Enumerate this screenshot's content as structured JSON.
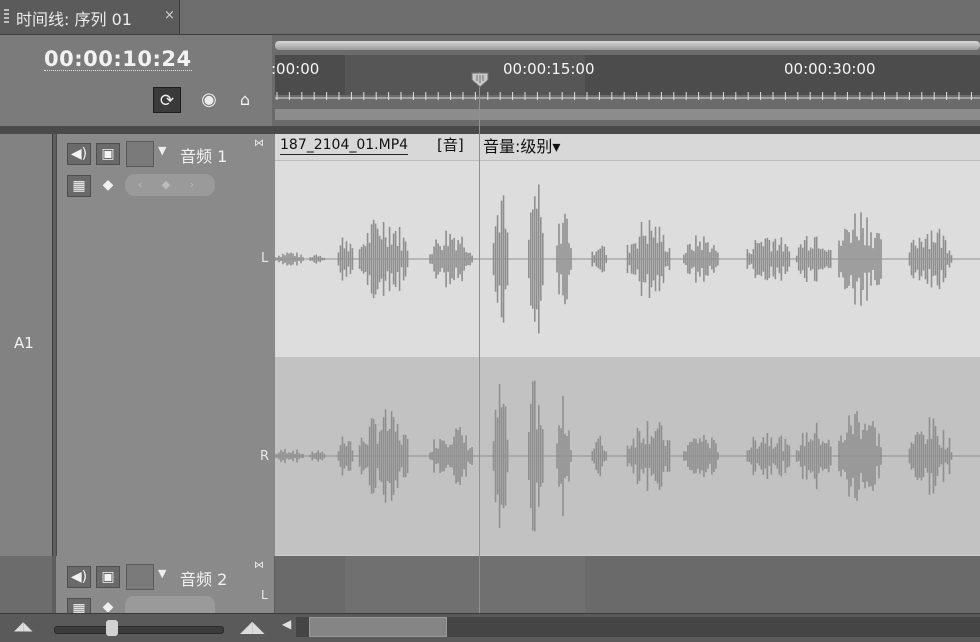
{
  "panel": {
    "tab_title": "时间线: 序列 01",
    "close_glyph": "×",
    "timecode": "00:00:10:24"
  },
  "toolbar": {
    "snap_icon": "snap-icon",
    "marker_icon": "marker-icon",
    "keyframe_icon": "keyframe-icon",
    "snap_glyph": "⟳",
    "marker_glyph": "◉",
    "keyframe_glyph": "⌂"
  },
  "ruler": {
    "labels": [
      ":00:00",
      "00:00:15:00",
      "00:00:30:00"
    ]
  },
  "tracks": [
    {
      "id": "A1",
      "name": "音频 1",
      "speaker_glyph": "◀)",
      "lock_glyph": "▣",
      "collapse_glyph": "▼",
      "wave_glyph": "▦",
      "kf_glyph": "◆",
      "nav_glyph": "‹ ◆ ›",
      "clip": {
        "name": "187_2104_01.MP4",
        "tag": "[音]",
        "volume": "音量:级别▾"
      },
      "channels": [
        "L",
        "R"
      ]
    },
    {
      "name": "音频 2",
      "speaker_glyph": "◀)",
      "lock_glyph": "▣",
      "collapse_glyph": "▼",
      "wave_glyph": "▦",
      "kf_glyph": "◆",
      "channels": [
        "L"
      ]
    }
  ],
  "bottom": {
    "zoom_out_glyph": "◢◣",
    "zoom_in_glyph": "◢◣",
    "scroll_left_glyph": "◀"
  },
  "colors": {
    "waveform": "#8f8f8f",
    "clip_bg": "#dddddd",
    "clip_bg_right": "#c2c2c2"
  },
  "waveform": {
    "segments": [
      [
        0.0,
        0.04,
        0.1
      ],
      [
        0.05,
        0.07,
        0.08
      ],
      [
        0.09,
        0.11,
        0.35
      ],
      [
        0.12,
        0.19,
        0.55
      ],
      [
        0.22,
        0.28,
        0.4
      ],
      [
        0.31,
        0.33,
        0.9
      ],
      [
        0.36,
        0.38,
        1.0
      ],
      [
        0.4,
        0.42,
        0.7
      ],
      [
        0.45,
        0.47,
        0.25
      ],
      [
        0.5,
        0.56,
        0.5
      ],
      [
        0.58,
        0.63,
        0.3
      ],
      [
        0.67,
        0.73,
        0.35
      ],
      [
        0.74,
        0.79,
        0.4
      ],
      [
        0.8,
        0.86,
        0.65
      ],
      [
        0.9,
        0.96,
        0.45
      ]
    ]
  }
}
